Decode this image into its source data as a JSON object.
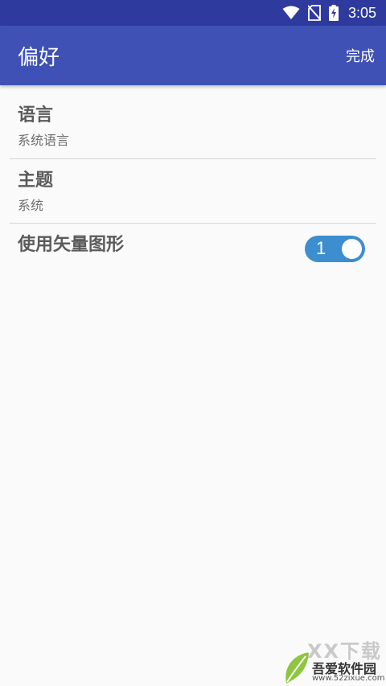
{
  "status_bar": {
    "time": "3:05",
    "icons": [
      "wifi-icon",
      "no-sim-icon",
      "battery-charging-icon"
    ]
  },
  "app_bar": {
    "title": "偏好",
    "done_label": "完成",
    "color": "#3f51b5"
  },
  "preferences": {
    "language": {
      "title": "语言",
      "summary": "系统语言"
    },
    "theme": {
      "title": "主题",
      "summary": "系统"
    },
    "vector_graphics": {
      "title": "使用矢量图形",
      "switch_value": "1",
      "enabled": true
    }
  },
  "watermark": {
    "brand_text": "吾爱软件园",
    "url": "www.52zixue.com",
    "overlay_text": "XX下载"
  },
  "colors": {
    "status_bar": "#2f3a9e",
    "accent": "#3d8ecf",
    "background": "#fafafa"
  }
}
